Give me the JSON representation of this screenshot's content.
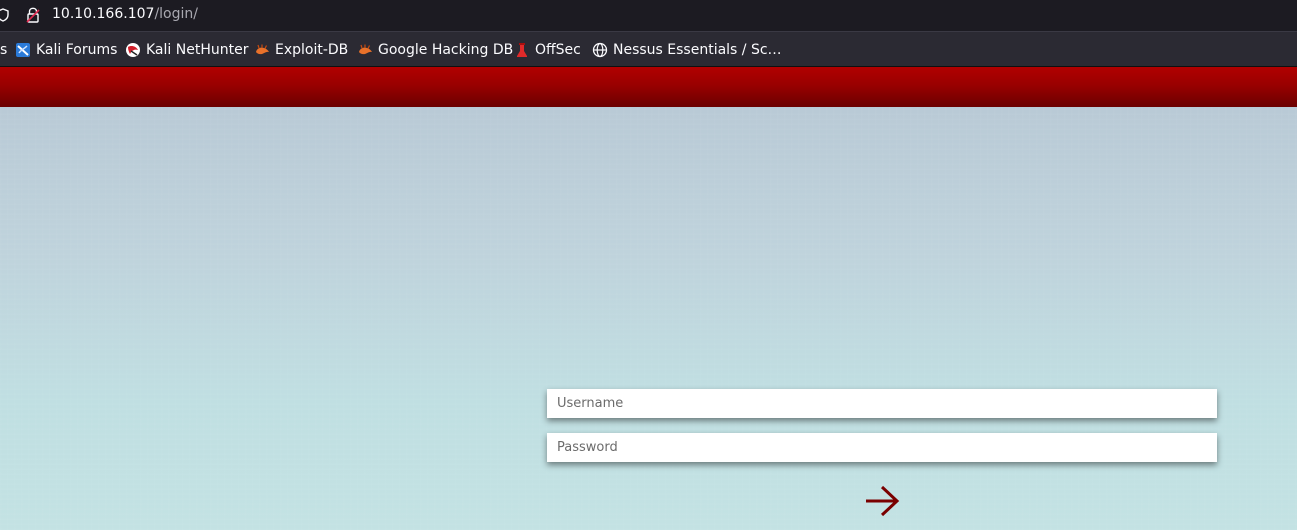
{
  "browser": {
    "url_host": "10.10.166.107",
    "url_path": "/login/"
  },
  "bookmarks": [
    {
      "label": "s",
      "icon": "partial-icon"
    },
    {
      "label": "Kali Forums",
      "icon": "kali-forums-icon"
    },
    {
      "label": "Kali NetHunter",
      "icon": "kali-nethunter-icon"
    },
    {
      "label": "Exploit-DB",
      "icon": "exploit-db-icon"
    },
    {
      "label": "Google Hacking DB",
      "icon": "exploit-db-icon"
    },
    {
      "label": "OffSec",
      "icon": "offsec-icon"
    },
    {
      "label": "Nessus Essentials / Sc…",
      "icon": "globe-icon"
    }
  ],
  "login": {
    "username_placeholder": "Username",
    "password_placeholder": "Password",
    "submit_icon": "arrow-right-icon"
  },
  "colors": {
    "topbar": "#990000",
    "arrow": "#7a0000"
  }
}
